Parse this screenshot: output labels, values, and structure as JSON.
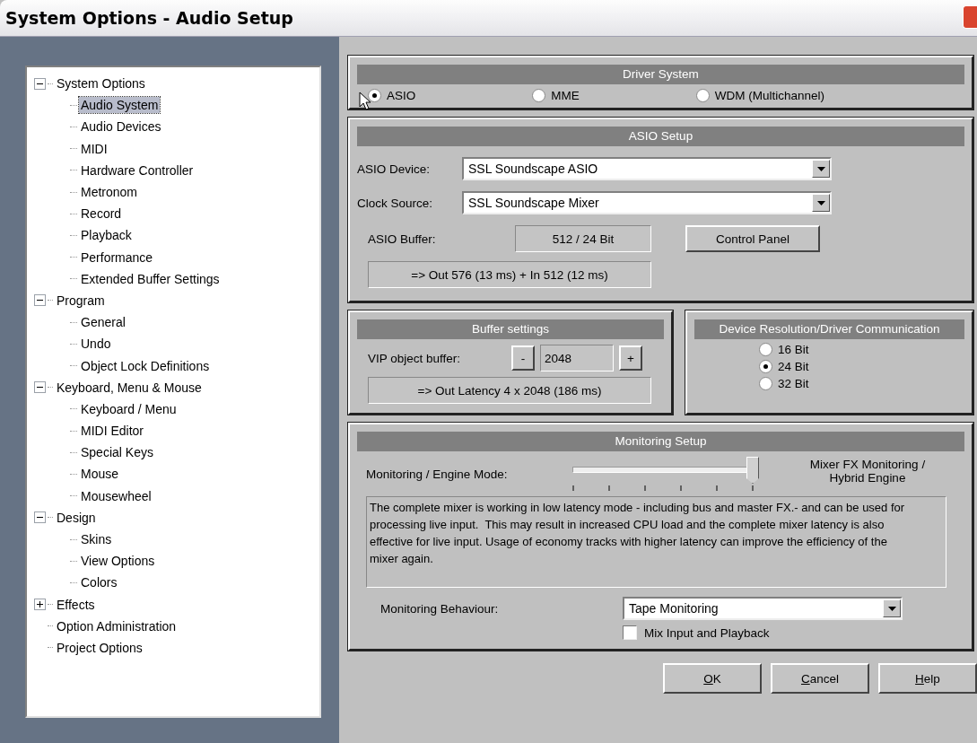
{
  "window": {
    "title": "System Options - Audio Setup"
  },
  "tree": [
    {
      "label": "System Options",
      "selected": false,
      "expanded": true,
      "children": [
        {
          "label": "Audio System",
          "selected": true
        },
        {
          "label": "Audio Devices",
          "selected": false
        },
        {
          "label": "MIDI",
          "selected": false
        },
        {
          "label": "Hardware Controller",
          "selected": false
        },
        {
          "label": "Metronom",
          "selected": false
        },
        {
          "label": "Record",
          "selected": false
        },
        {
          "label": "Playback",
          "selected": false
        },
        {
          "label": "Performance",
          "selected": false
        },
        {
          "label": "Extended Buffer Settings",
          "selected": false
        }
      ]
    },
    {
      "label": "Program",
      "selected": false,
      "expanded": true,
      "children": [
        {
          "label": "General",
          "selected": false
        },
        {
          "label": "Undo",
          "selected": false
        },
        {
          "label": "Object Lock Definitions",
          "selected": false
        }
      ]
    },
    {
      "label": "Keyboard, Menu & Mouse",
      "selected": false,
      "expanded": true,
      "children": [
        {
          "label": "Keyboard / Menu",
          "selected": false
        },
        {
          "label": "MIDI Editor",
          "selected": false
        },
        {
          "label": "Special Keys",
          "selected": false
        },
        {
          "label": "Mouse",
          "selected": false
        },
        {
          "label": "Mousewheel",
          "selected": false
        }
      ]
    },
    {
      "label": "Design",
      "selected": false,
      "expanded": true,
      "children": [
        {
          "label": "Skins",
          "selected": false
        },
        {
          "label": "View Options",
          "selected": false
        },
        {
          "label": "Colors",
          "selected": false
        }
      ]
    },
    {
      "label": "Effects",
      "selected": false,
      "expanded": false
    },
    {
      "label": "Option Administration",
      "selected": false
    },
    {
      "label": "Project Options",
      "selected": false
    }
  ],
  "driver_system": {
    "title": "Driver System",
    "options": [
      {
        "label": "ASIO",
        "selected": true
      },
      {
        "label": "MME",
        "selected": false
      },
      {
        "label": "WDM (Multichannel)",
        "selected": false
      }
    ]
  },
  "asio_setup": {
    "title": "ASIO Setup",
    "device_label": "ASIO Device:",
    "device_value": "SSL Soundscape ASIO",
    "clock_label": "Clock Source:",
    "clock_value": "SSL Soundscape Mixer",
    "buffer_label": "ASIO Buffer:",
    "buffer_value": "512 / 24 Bit",
    "control_panel_button": "Control Panel",
    "latency": "=> Out 576 (13 ms) + In 512 (12 ms)"
  },
  "buffer_settings": {
    "title": "Buffer settings",
    "vip_label": "VIP object buffer:",
    "decrement": "-",
    "value": "2048",
    "increment": "+",
    "latency": "=> Out Latency 4 x 2048 (186 ms)"
  },
  "device_resolution": {
    "title": "Device Resolution/Driver Communication",
    "options": [
      {
        "label": "16 Bit",
        "selected": false
      },
      {
        "label": "24 Bit",
        "selected": true
      },
      {
        "label": "32 Bit",
        "selected": false
      }
    ]
  },
  "monitoring": {
    "title": "Monitoring Setup",
    "mode_label": "Monitoring / Engine Mode:",
    "mode_slider": {
      "level": 1
    },
    "mode_value": "Mixer FX Monitoring / Hybrid Engine",
    "description": "The complete mixer is working in low latency mode - including bus and master FX.- and can be used for processing live input.  This may result in increased CPU load and the complete mixer latency is also effective for live input. Usage of economy tracks with higher latency can improve the efficiency of the mixer again.",
    "behaviour_label": "Monitoring Behaviour:",
    "behaviour_value": "Tape Monitoring",
    "mix_input": {
      "label": "Mix Input and Playback",
      "checked": false
    }
  },
  "buttons": [
    {
      "label": "OK"
    },
    {
      "label": "Cancel"
    },
    {
      "label": "Help"
    }
  ]
}
